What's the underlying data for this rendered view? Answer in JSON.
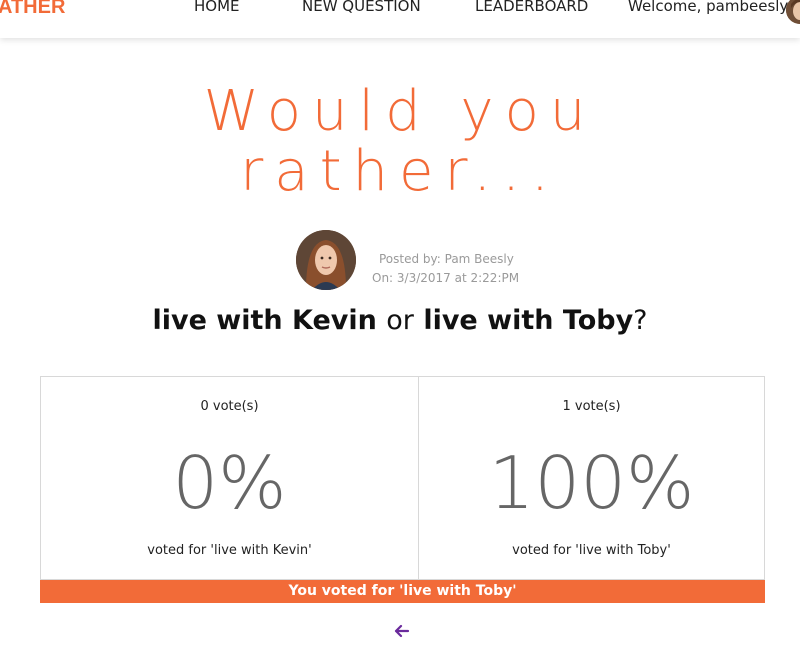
{
  "colors": {
    "brand": "#f26b38",
    "accent": "#f26b38",
    "back_arrow": "#6a2a9c",
    "percent_text": "#666666"
  },
  "nav": {
    "brand": "ATHER",
    "home": "HOME",
    "new_question": "NEW QUESTION",
    "leaderboard": "LEADERBOARD",
    "welcome": "Welcome, pambeesly",
    "avatar_icon": "user-avatar"
  },
  "hero": {
    "line1": "Would you",
    "line2": "rather..."
  },
  "post": {
    "posted_by": "Posted by: Pam Beesly",
    "posted_on": "On: 3/3/2017 at 2:22:PM",
    "avatar_icon": "author-avatar"
  },
  "question": {
    "option_one": "live with Kevin",
    "separator": "or",
    "option_two": "live with Toby",
    "end": "?"
  },
  "results": [
    {
      "votes": "0 vote(s)",
      "percent": "0%",
      "voted_for": "voted for 'live with Kevin'"
    },
    {
      "votes": "1 vote(s)",
      "percent": "100%",
      "voted_for": "voted for 'live with Toby'"
    }
  ],
  "your_vote": "You voted for 'live with Toby'",
  "back_icon": "arrow-left-icon"
}
